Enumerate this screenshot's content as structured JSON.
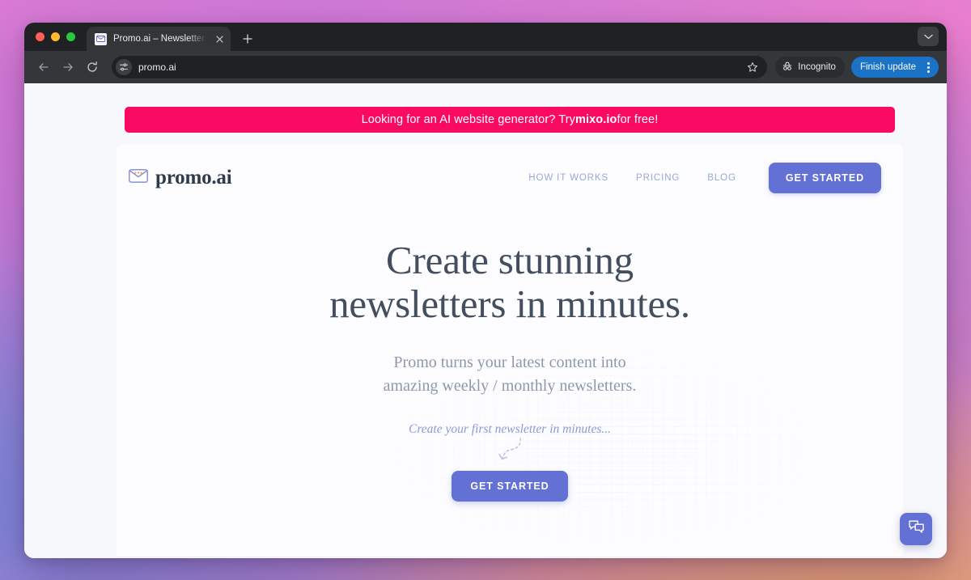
{
  "browser": {
    "tab": {
      "title": "Promo.ai – Newsletters made",
      "favicon_icon": "envelope-favicon",
      "close_icon": "close-icon"
    },
    "new_tab_icon": "plus-icon",
    "tab_list_icon": "chevron-down-icon",
    "nav": {
      "back_icon": "back-arrow-icon",
      "forward_icon": "forward-arrow-icon",
      "reload_icon": "reload-icon"
    },
    "omnibox": {
      "url": "promo.ai",
      "site_settings_icon": "tune-icon",
      "bookmark_icon": "star-icon"
    },
    "incognito": {
      "label": "Incognito",
      "icon": "incognito-hat-icon"
    },
    "update": {
      "label": "Finish update",
      "menu_icon": "kebab-menu-icon"
    },
    "traffic_lights": [
      "close",
      "minimize",
      "maximize"
    ]
  },
  "page": {
    "promo_banner": {
      "prefix": "Looking for an AI website generator? Try ",
      "brand": "mixo.io",
      "suffix": " for free!",
      "background_color": "#fa0a63",
      "text_color": "#ffffff"
    },
    "header": {
      "logo_icon": "envelope-logo-icon",
      "brand_name": "promo.ai",
      "nav_links": [
        {
          "label": "HOW IT WORKS"
        },
        {
          "label": "PRICING"
        },
        {
          "label": "BLOG"
        }
      ],
      "cta_label": "GET STARTED"
    },
    "hero": {
      "title_line1": "Create stunning",
      "title_line2": "newsletters in minutes.",
      "subtitle_line1": "Promo turns your latest content into",
      "subtitle_line2": "amazing weekly / monthly newsletters.",
      "kicker": "Create your first newsletter in minutes...",
      "arrow_icon": "curved-dashed-arrow-icon",
      "cta_label": "GET STARTED"
    },
    "chat_widget": {
      "icon": "chat-bubbles-icon"
    },
    "colors": {
      "accent": "#6370d4",
      "promo": "#fa0a63",
      "heading": "#434e5e",
      "muted": "#8e98ab",
      "nav_link": "#9aa6d6"
    }
  }
}
